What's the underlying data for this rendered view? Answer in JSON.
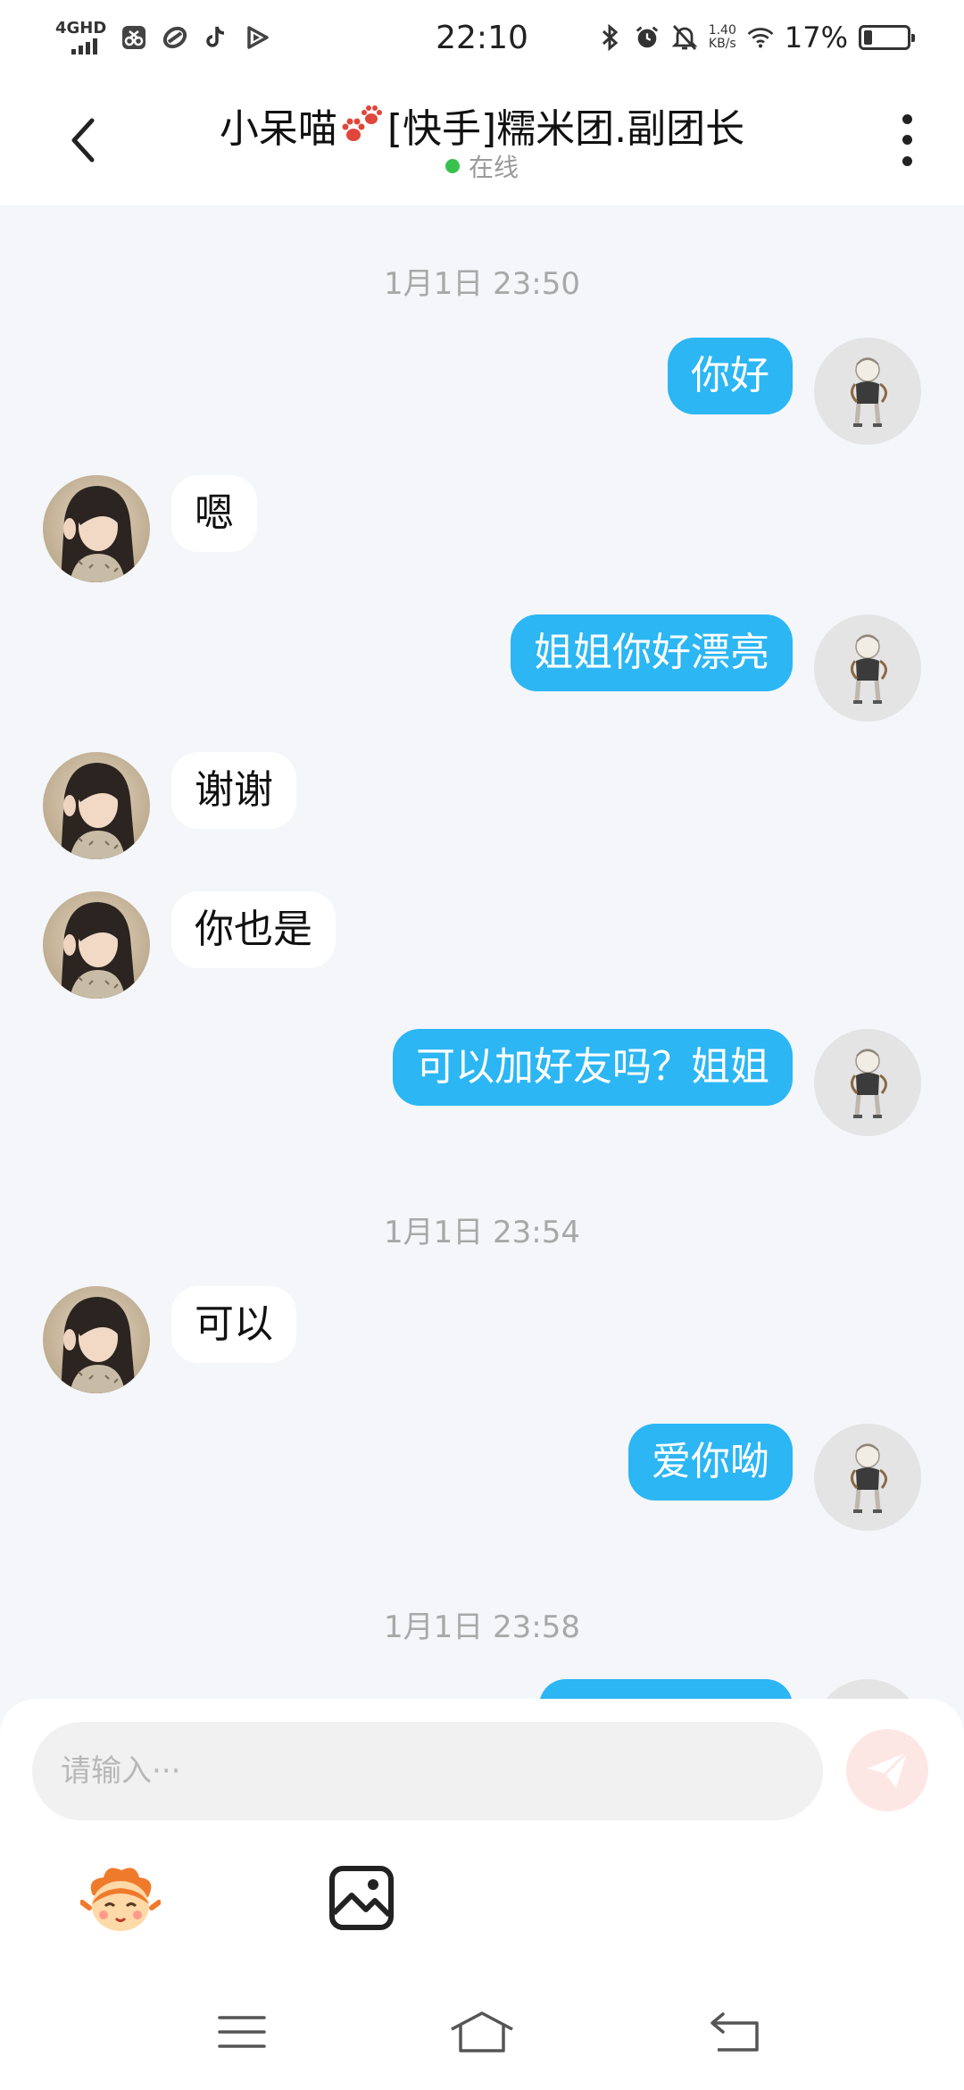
{
  "status_bar": {
    "network": "4GHD",
    "time": "22:10",
    "speed_value": "1.40",
    "speed_unit": "KB/s",
    "battery": "17%"
  },
  "header": {
    "title": "小呆喵",
    "title_suffix": "[快手]糯米团.副团长",
    "presence": "在线"
  },
  "chat": {
    "timestamps": [
      "1月1日 23:50",
      "1月1日 23:54",
      "1月1日 23:58"
    ],
    "messages": [
      {
        "side": "out",
        "text": "你好"
      },
      {
        "side": "in",
        "text": "嗯"
      },
      {
        "side": "out",
        "text": "姐姐你好漂亮"
      },
      {
        "side": "in",
        "text": "谢谢"
      },
      {
        "side": "in",
        "text": "你也是"
      },
      {
        "side": "out",
        "text": "可以加好友吗？姐姐"
      },
      {
        "side": "in",
        "text": "可以"
      },
      {
        "side": "out",
        "text": "爱你呦"
      }
    ]
  },
  "composer": {
    "placeholder": "请输入···"
  },
  "colors": {
    "outgoing_bubble": "#2cb6f4",
    "incoming_bubble": "#ffffff",
    "background": "#f4f6f9",
    "online_dot": "#37c24d",
    "send_button": "#fde7e5"
  },
  "icons": {
    "back": "chevron-left-icon",
    "more": "more-vertical-icon",
    "send": "paper-plane-icon",
    "emoji": "mascot-emoji-icon",
    "image": "image-icon",
    "nav_menu": "menu-icon",
    "nav_home": "home-icon",
    "nav_back": "back-arrow-icon"
  }
}
